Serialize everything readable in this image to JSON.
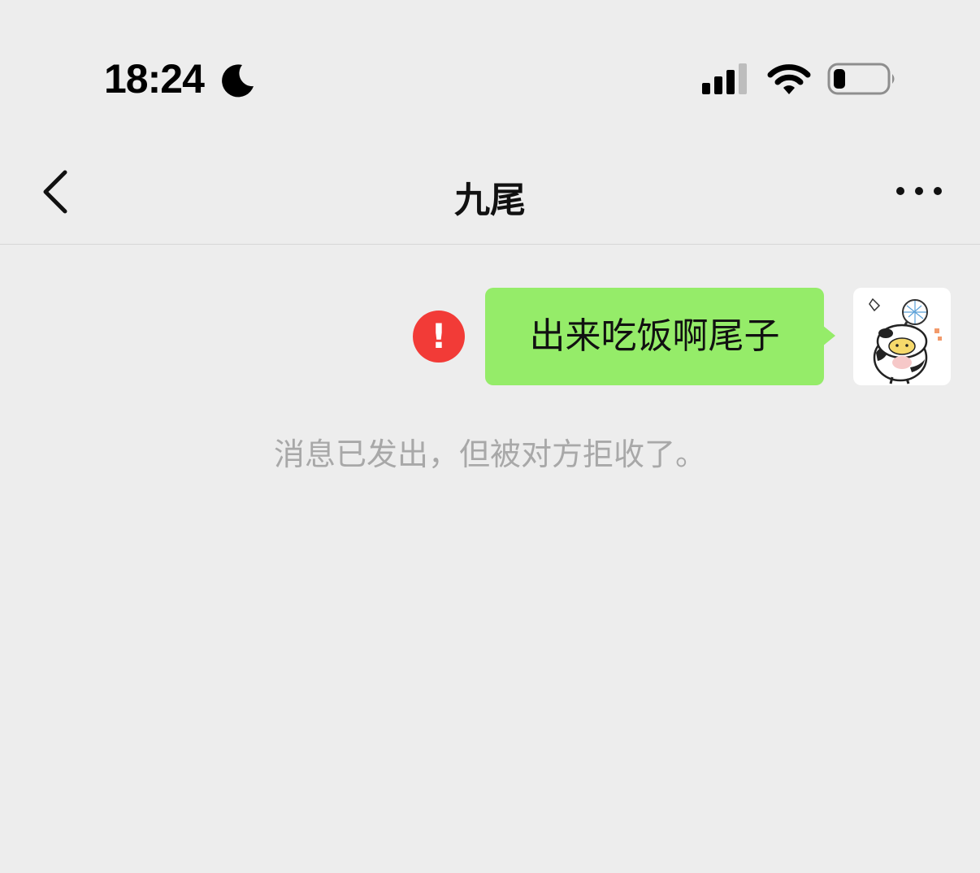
{
  "status_bar": {
    "time": "18:24",
    "icons": [
      "moon-icon",
      "cellular-signal-icon",
      "wifi-icon",
      "battery-icon"
    ]
  },
  "nav": {
    "title": "九尾",
    "back_icon": "chevron-left-icon",
    "more_icon": "more-dots-icon"
  },
  "messages": [
    {
      "direction": "outgoing",
      "text": "出来吃饭啊尾子",
      "status": "failed",
      "status_symbol": "!",
      "avatar": "cartoon-cow-avatar"
    }
  ],
  "system_notice": "消息已发出，但被对方拒收了。",
  "colors": {
    "background": "#ededed",
    "bubble_outgoing": "#95ec69",
    "error_red": "#f23b37",
    "notice_text": "#a8a8a8"
  }
}
